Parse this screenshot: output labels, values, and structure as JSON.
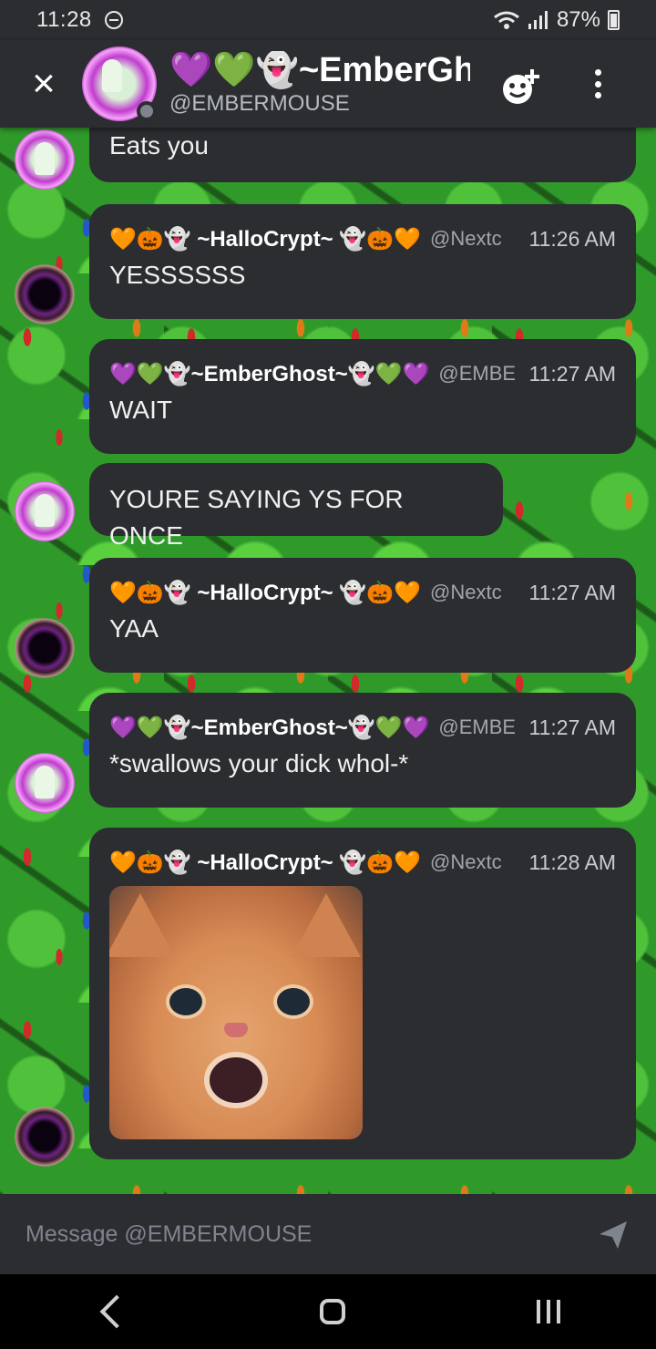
{
  "status_bar": {
    "time": "11:28",
    "battery": "87%"
  },
  "header": {
    "close_label": "×",
    "contact_name": "💜💚👻~EmberGh",
    "contact_handle": "@EMBERMOUSE"
  },
  "messages": [
    {
      "author": "",
      "handle": "",
      "time": "",
      "text": "Eats you"
    },
    {
      "author": "🧡🎃👻 ~HalloCrypt~ 👻🎃🧡",
      "handle": "@Nextc",
      "time": "11:26 AM",
      "text": "YESSSSSS"
    },
    {
      "author": "💜💚👻~EmberGhost~👻💚💜",
      "handle": "@EMBE",
      "time": "11:27 AM",
      "text": "WAIT"
    },
    {
      "author": "",
      "handle": "",
      "time": "",
      "text": "YOURE SAYING YS FOR ONCE"
    },
    {
      "author": "🧡🎃👻 ~HalloCrypt~ 👻🎃🧡",
      "handle": "@Nextc",
      "time": "11:27 AM",
      "text": "YAA"
    },
    {
      "author": "💜💚👻~EmberGhost~👻💚💜",
      "handle": "@EMBE",
      "time": "11:27 AM",
      "text": "*swallows your dick whol-*"
    },
    {
      "author": "🧡🎃👻 ~HalloCrypt~ 👻🎃🧡",
      "handle": "@Nextc",
      "time": "11:28 AM",
      "text": ""
    }
  ],
  "composer": {
    "placeholder": "Message @EMBERMOUSE"
  },
  "colors": {
    "chat_background": "#2f9a2a",
    "bubble": "#2b2d31",
    "ghost_ring": "#c23bd0"
  },
  "icons": [
    "sync-icon",
    "wifi-icon",
    "signal-icon",
    "battery-icon",
    "close-icon",
    "add-friend-icon",
    "more-options-icon",
    "send-icon",
    "nav-back-icon",
    "nav-home-icon",
    "nav-recents-icon"
  ]
}
